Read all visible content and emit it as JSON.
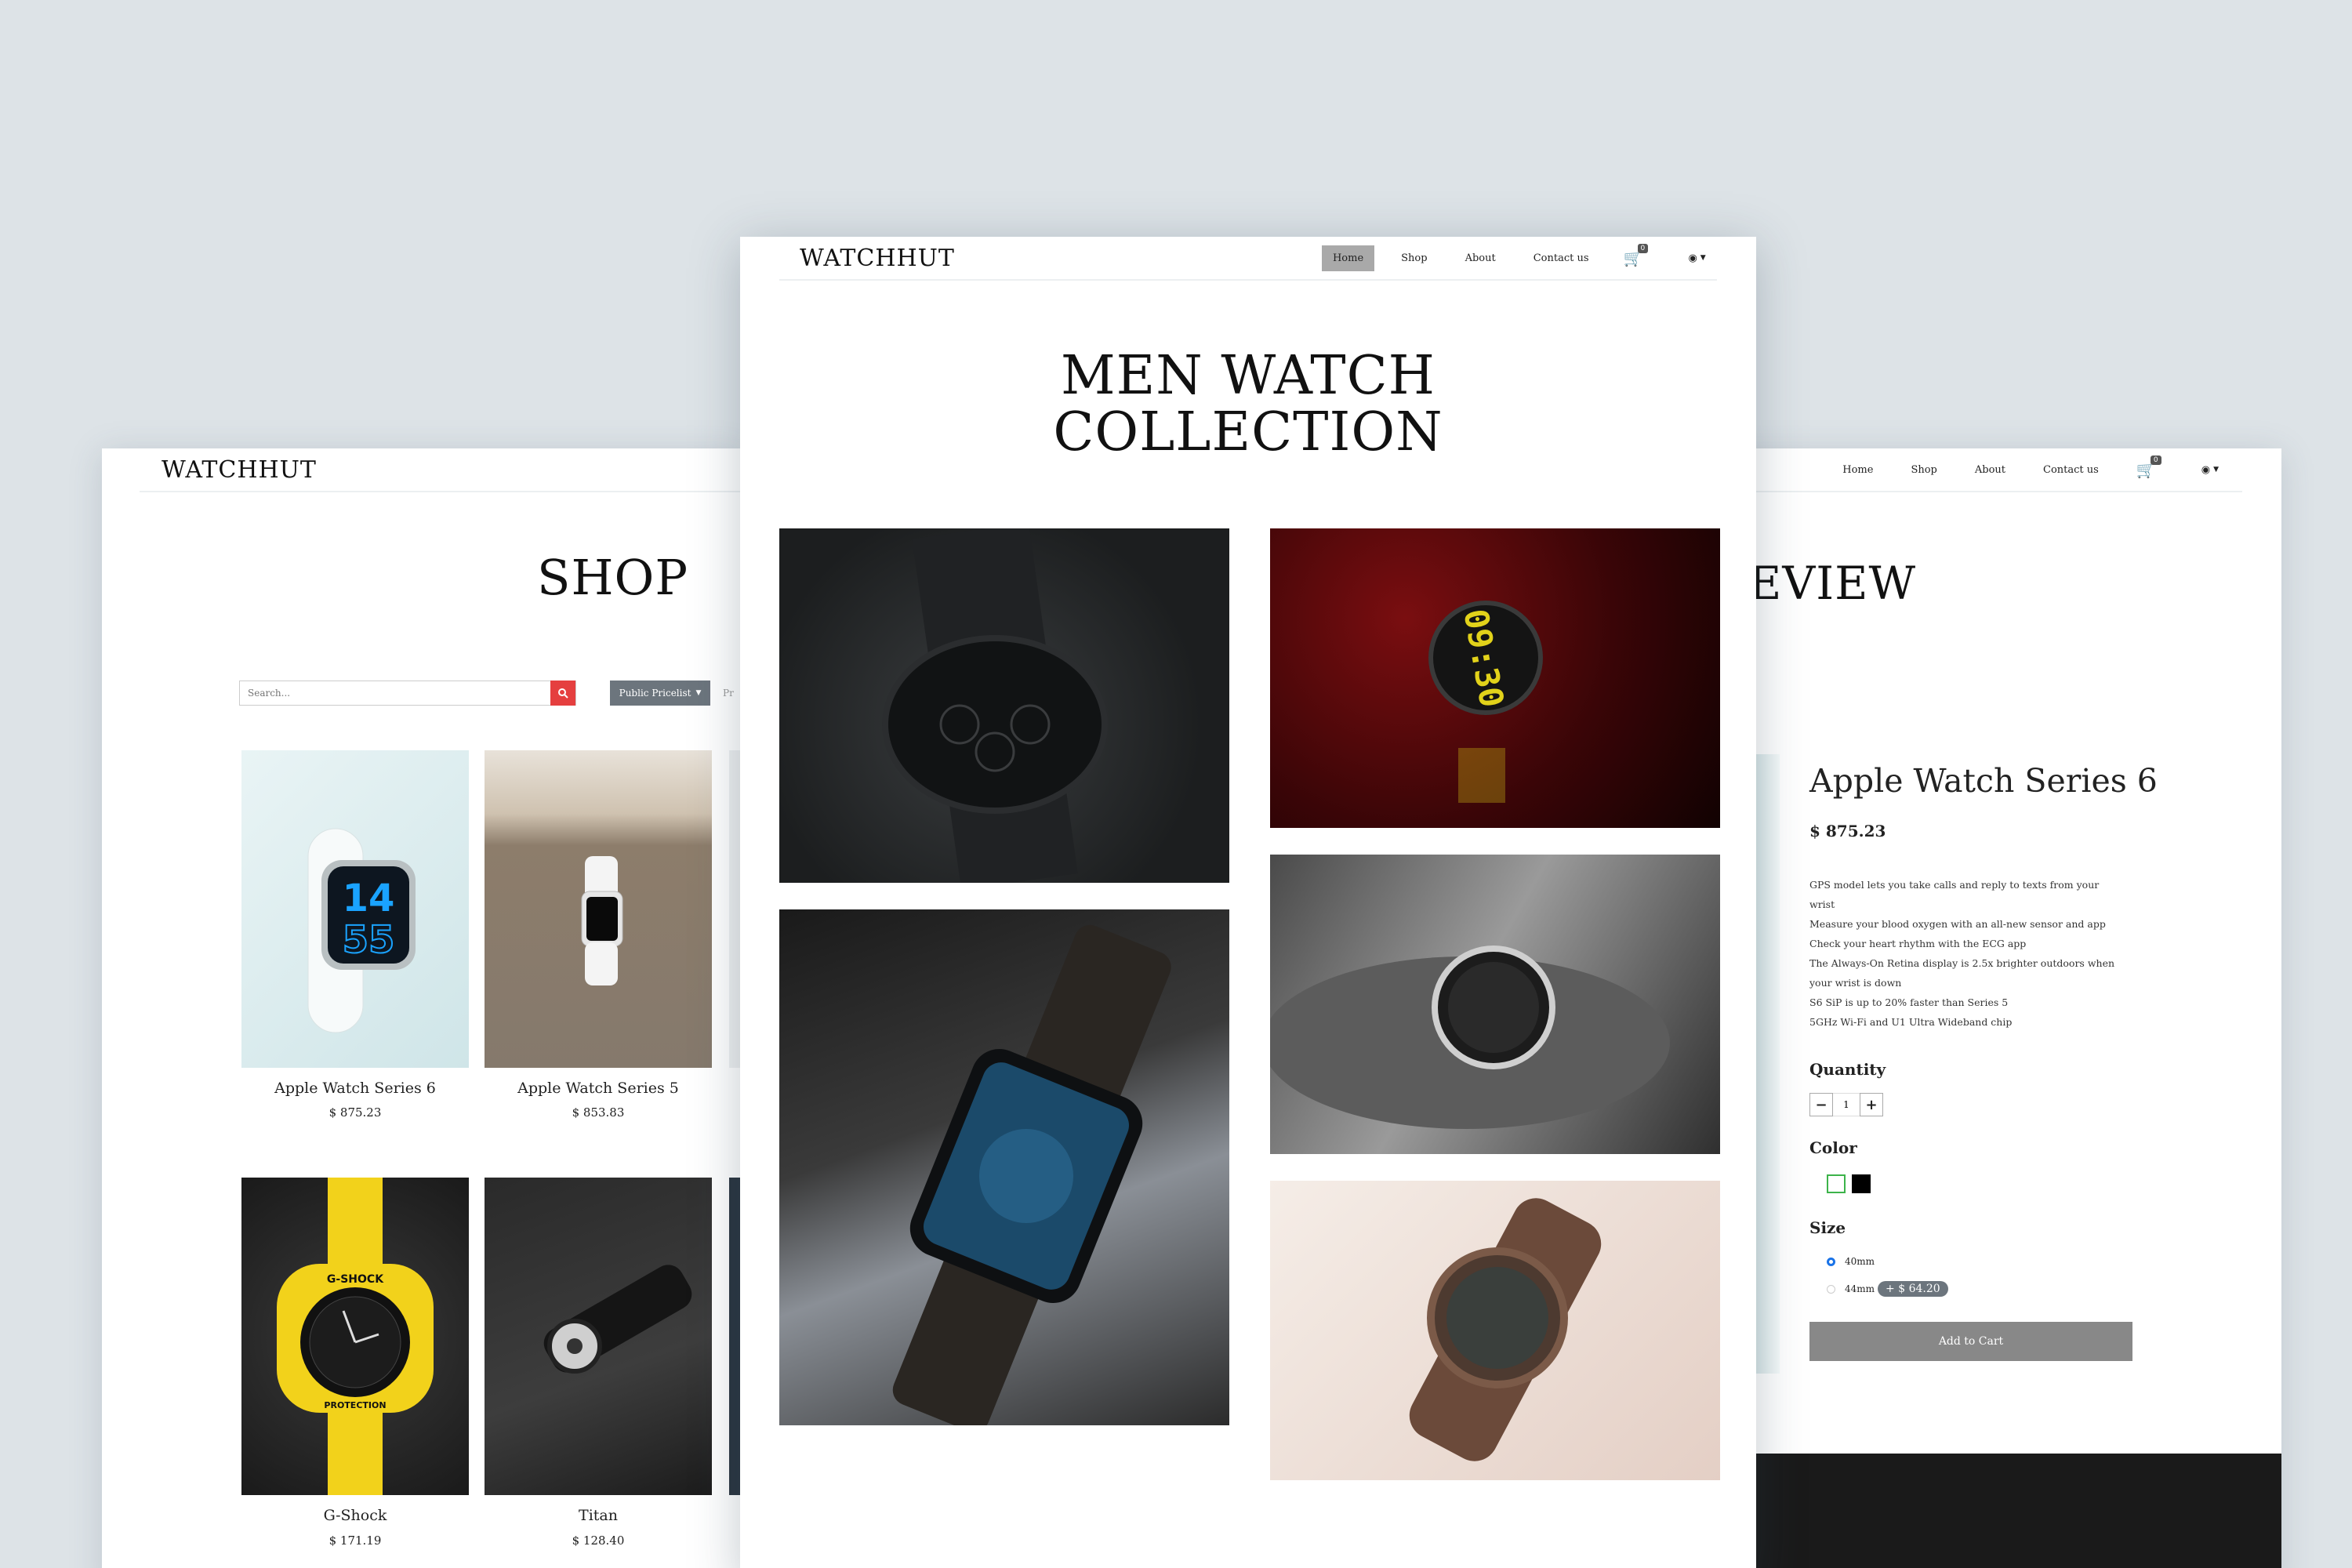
{
  "brand": {
    "logo": "WATCHHUT"
  },
  "nav": {
    "home": "Home",
    "shop": "Shop",
    "about": "About",
    "contact": "Contact us",
    "cart_count": "0"
  },
  "shop_page": {
    "title": "SHOP",
    "search_placeholder": "Search...",
    "pricelist_label": "Public Pricelist",
    "next_filter_stub": "Pr",
    "products": [
      {
        "name": "Apple Watch Series 6",
        "price": "$ 875.23"
      },
      {
        "name": "Apple Watch Series 5",
        "price": "$ 853.83"
      },
      {
        "name": "G-Shock",
        "price": "$ 171.19"
      },
      {
        "name": "Titan",
        "price": "$ 128.40"
      }
    ],
    "image_text": {
      "watch_time_top": "14",
      "watch_time_bottom": "55",
      "gshock_brand": "G-SHOCK",
      "gshock_band": "PROTECTION"
    }
  },
  "home_page": {
    "title_line1": "MEN WATCH",
    "title_line2": "COLLECTION",
    "image_text": {
      "digital_time": "09:30"
    }
  },
  "product_page": {
    "title_stub": "EVIEW",
    "name": "Apple Watch Series 6",
    "price": "$ 875.23",
    "description": [
      "GPS model lets you take calls and reply to texts from your",
      "wrist",
      "Measure your blood oxygen with an all-new sensor and app",
      "Check your heart rhythm with the ECG app",
      "The Always-On Retina display is 2.5x brighter outdoors when",
      "your wrist is down",
      "S6 SiP is up to 20% faster than Series 5",
      "5GHz Wi-Fi and U1 Ultra Wideband chip"
    ],
    "quantity_label": "Quantity",
    "quantity_value": "1",
    "minus": "−",
    "plus": "+",
    "color_label": "Color",
    "size_label": "Size",
    "sizes": [
      {
        "label": "40mm",
        "extra": ""
      },
      {
        "label": "44mm",
        "extra": "+ $ 64.20"
      }
    ],
    "add_to_cart": "Add to Cart"
  },
  "colors": {
    "accent_red": "#e53f3f",
    "button_gray": "#888888",
    "pricelist_gray": "#6c757d"
  }
}
